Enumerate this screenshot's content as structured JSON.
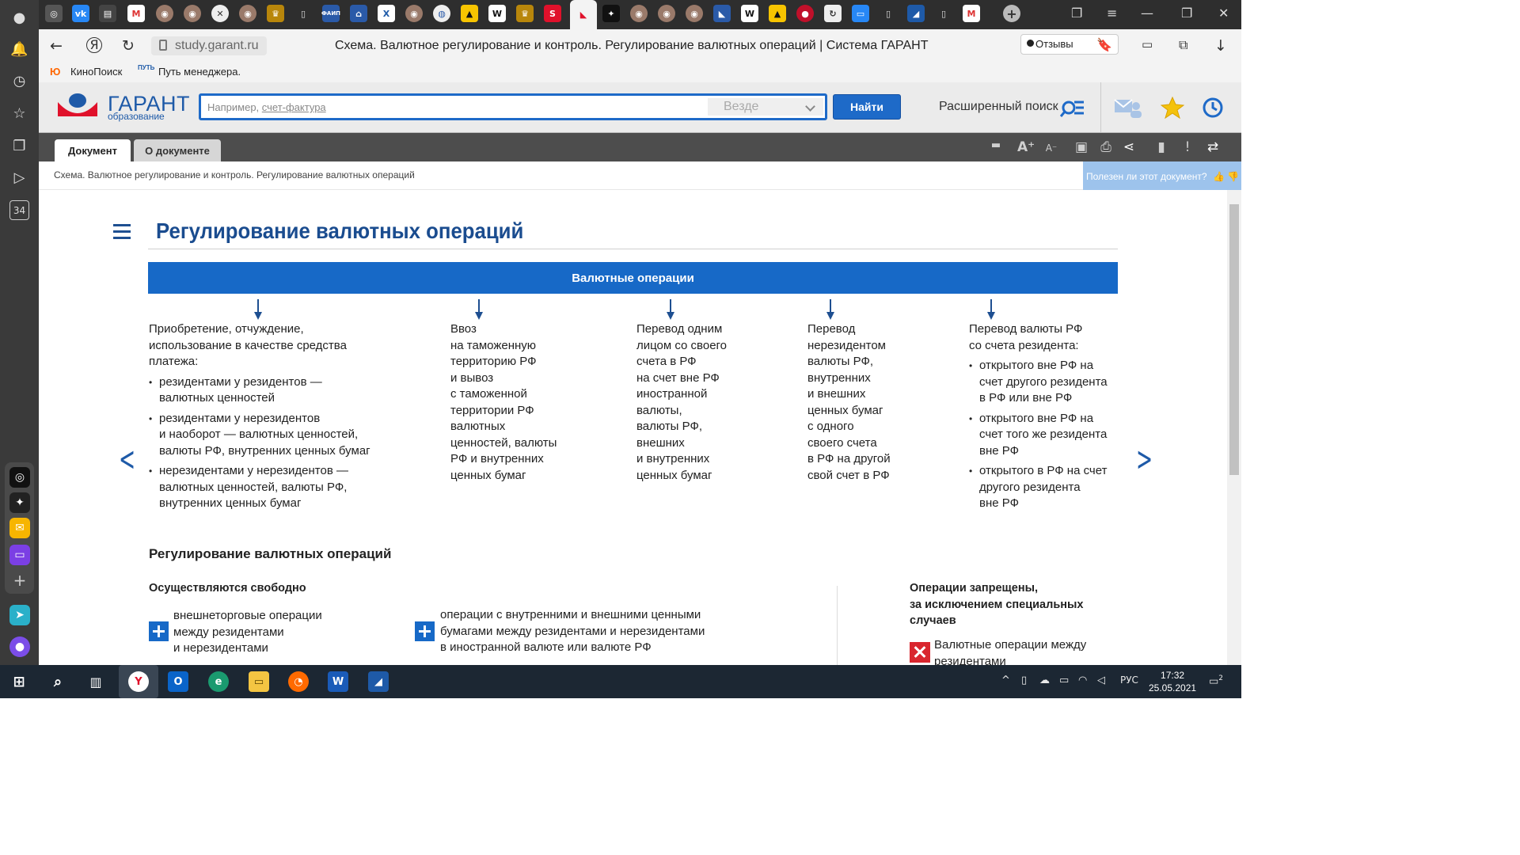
{
  "browser": {
    "url": "study.garant.ru",
    "page_title": "Схема. Валютное регулирование и контроль. Регулирование валютных операций | Система ГАРАНТ",
    "reviews_label": "Отзывы",
    "bookmarks": [
      "КиноПоиск",
      "Путь менеджера."
    ],
    "sidebar_badge": "34"
  },
  "garant": {
    "logo": "ГАРАНТ",
    "logo_sub": "образование",
    "search_placeholder_prefix": "Например, ",
    "search_placeholder_link": "счет-фактура",
    "search_scope": "Везде",
    "find_button": "Найти",
    "advanced_search": "Расширенный поиск"
  },
  "doc_tabs": [
    "Документ",
    "О документе"
  ],
  "breadcrumb": "Схема. Валютное регулирование и контроль. Регулирование валютных операций",
  "useful_prompt": "Полезен ли этот документ?",
  "content": {
    "title": "Регулирование валютных операций",
    "banner": "Валютные операции",
    "columns": [
      {
        "intro": "Приобретение, отчуждение,\nиспользование в качестве средства\nплатежа:",
        "items": [
          "резидентами у резидентов —\nвалютных ценностей",
          "резидентами у нерезидентов\nи наоборот — валютных ценностей,\nвалюты РФ, внутренних ценных бумаг",
          "нерезидентами у нерезидентов —\nвалютных ценностей, валюты РФ,\nвнутренних ценных бумаг"
        ]
      },
      {
        "intro": "Ввоз\nна таможенную\nтерриторию РФ\nи вывоз\nс таможенной\nтерритории РФ\nвалютных\nценностей, валюты\nРФ и внутренних\nценных бумаг",
        "items": []
      },
      {
        "intro": "Перевод одним\nлицом со своего\nсчета в РФ\nна счет вне РФ\nиностранной\nвалюты,\nвалюты РФ,\nвнешних\nи внутренних\nценных бумаг",
        "items": []
      },
      {
        "intro": "Перевод\nнерезидентом\nвалюты РФ,\nвнутренних\nи внешних\nценных бумаг\nс одного\nсвоего счета\nв РФ на другой\nсвой счет в РФ",
        "items": []
      },
      {
        "intro": "Перевод валюты РФ\nсо счета резидента:",
        "items": [
          "открытого вне РФ на\nсчет другого резидента\nв РФ или вне РФ",
          "открытого вне РФ на\nсчет того же резидента\nвне РФ",
          "открытого в РФ на счет\nдругого резидента\nвне РФ"
        ]
      }
    ],
    "section_title": "Регулирование валютных операций",
    "free_title": "Осуществляются свободно",
    "free_ops": [
      "внешнеторговые операции\nмежду резидентами\nи нерезидентами",
      "операции с внутренними и внешними ценными\nбумагами между резидентами и нерезидентами\nв иностранной валюте или валюте РФ"
    ],
    "forbidden_title": "Операции запрещены,\nза исключением специальных\nслучаев",
    "forbidden_ops": [
      "Валютные операции между\nрезидентами"
    ]
  },
  "taskbar": {
    "lang": "РУС",
    "time": "17:32",
    "date": "25.05.2021",
    "notifications": "2"
  },
  "colors": {
    "accent": "#1769c7",
    "title": "#1a4c8f",
    "forbidden": "#d9262e"
  }
}
